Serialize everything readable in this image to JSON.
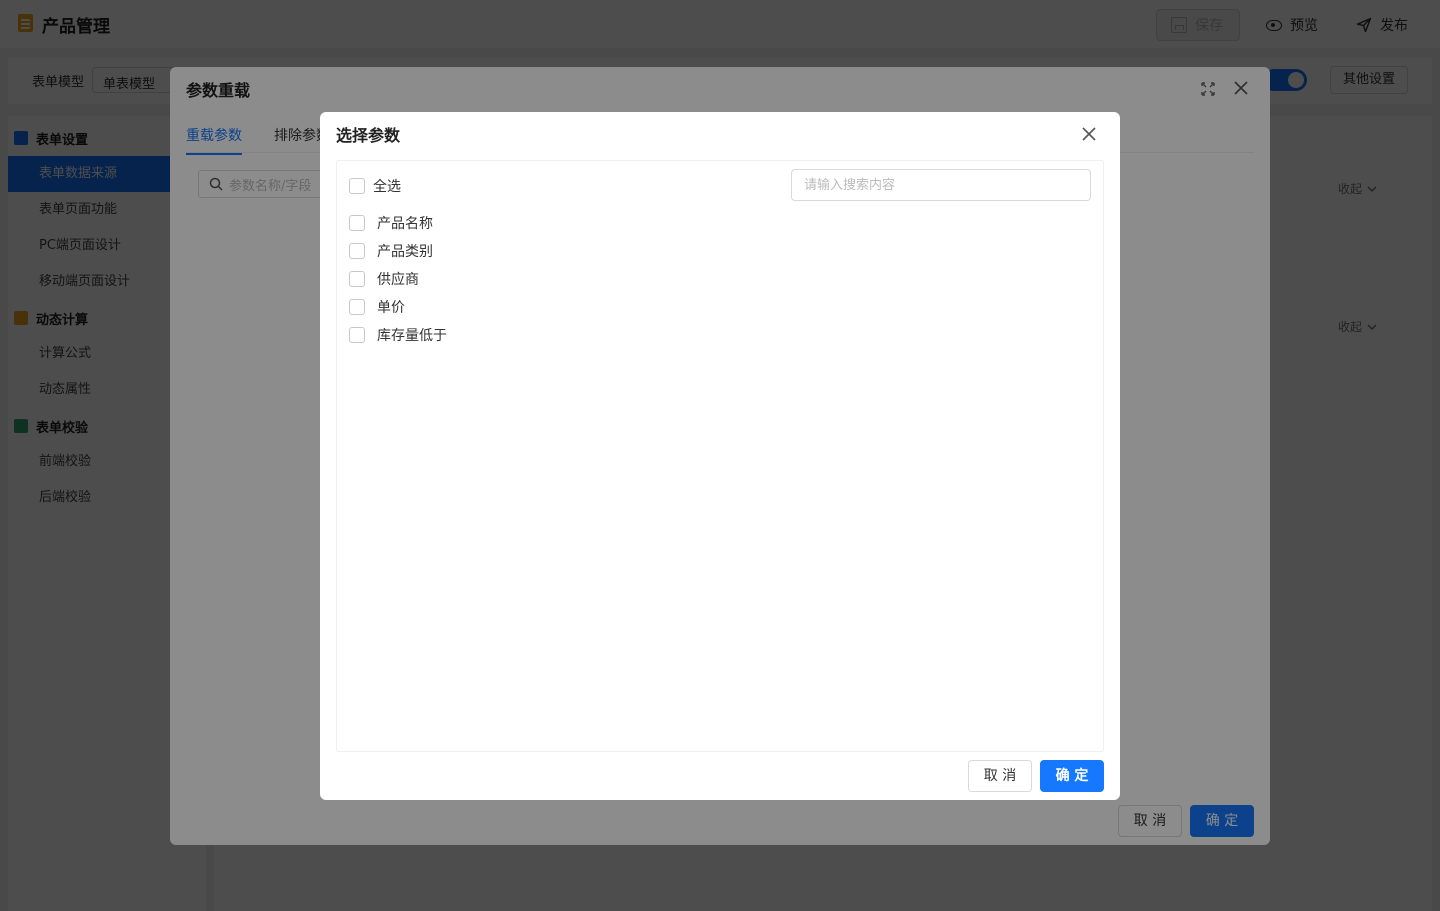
{
  "app": {
    "title": "产品管理"
  },
  "toolbar": {
    "save_label": "保存",
    "preview_label": "预览",
    "publish_label": "发布"
  },
  "subbar": {
    "model_label": "表单模型",
    "model_value": "单表模型",
    "other_settings_label": "其他设置"
  },
  "sidebar": {
    "groups": [
      {
        "label": "表单设置",
        "color": "#1677ff",
        "items": [
          "表单数据来源",
          "表单页面功能",
          "PC端页面设计",
          "移动端页面设计"
        ]
      },
      {
        "label": "动态计算",
        "color": "#f5a623",
        "items": [
          "计算公式",
          "动态属性"
        ]
      },
      {
        "label": "表单校验",
        "color": "#2fa872",
        "items": [
          "前端校验",
          "后端校验"
        ]
      }
    ],
    "active_item": "表单数据来源"
  },
  "content": {
    "collapse_label": "收起"
  },
  "reload_modal": {
    "title": "参数重载",
    "tabs": [
      "重载参数",
      "排除参数"
    ],
    "search_placeholder": "参数名称/字段",
    "cancel_label": "取 消",
    "ok_label": "确 定"
  },
  "select_modal": {
    "title": "选择参数",
    "select_all_label": "全选",
    "search_placeholder": "请输入搜索内容",
    "items": [
      "产品名称",
      "产品类别",
      "供应商",
      "单价",
      "库存量低于"
    ],
    "cancel_label": "取 消",
    "ok_label": "确 定"
  },
  "colors": {
    "primary": "#1677ff"
  }
}
